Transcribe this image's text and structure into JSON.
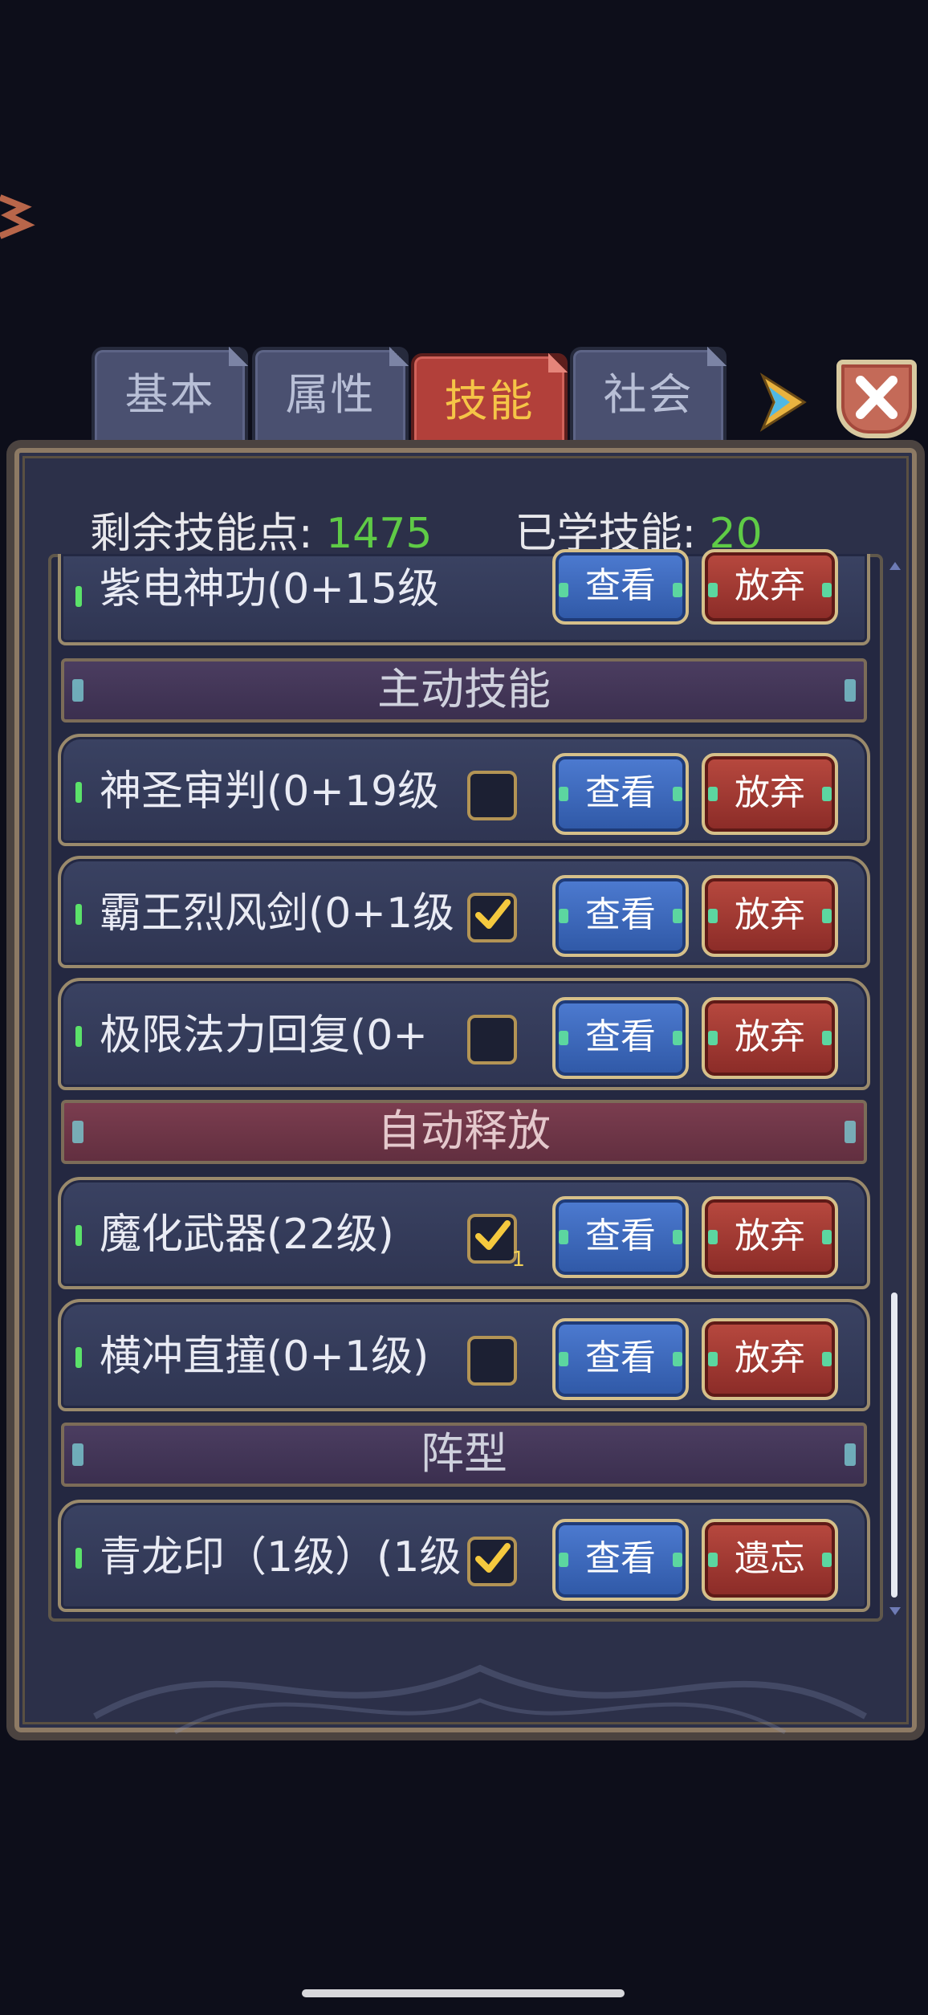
{
  "tabs": [
    {
      "label": "基本",
      "active": false
    },
    {
      "label": "属性",
      "active": false
    },
    {
      "label": "技能",
      "active": true
    },
    {
      "label": "社会",
      "active": false
    }
  ],
  "stats": {
    "remaining_label": "剩余技能点:",
    "remaining_value": "1475",
    "learned_label": "已学技能:",
    "learned_value": "20"
  },
  "top_partial_skill": {
    "name": "紫电神功(0+15级",
    "view": "查看",
    "drop": "放弃"
  },
  "sections": {
    "active": "主动技能",
    "auto": "自动释放",
    "formation": "阵型"
  },
  "active_skills": [
    {
      "name": "神圣审判(0+19级",
      "checked": false,
      "view": "查看",
      "drop": "放弃"
    },
    {
      "name": "霸王烈风剑(0+1级",
      "checked": true,
      "view": "查看",
      "drop": "放弃"
    },
    {
      "name": "极限法力回复(0+",
      "checked": false,
      "view": "查看",
      "drop": "放弃"
    }
  ],
  "auto_skills": [
    {
      "name": "魔化武器(22级)",
      "checked": true,
      "badge": "1",
      "view": "查看",
      "drop": "放弃"
    },
    {
      "name": "横冲直撞(0+1级)",
      "checked": false,
      "view": "查看",
      "drop": "放弃"
    }
  ],
  "formation_skills": [
    {
      "name": "青龙印（1级）(1级",
      "checked": true,
      "view": "查看",
      "drop": "遗忘"
    }
  ],
  "colors": {
    "background": "#0d0e1a",
    "panel": "#2c3049",
    "active_tab": "#b2403a",
    "active_tab_text": "#f5c547",
    "stat_number": "#5fcb46",
    "view_button": "#3f6cc0",
    "drop_button": "#a53c35"
  }
}
